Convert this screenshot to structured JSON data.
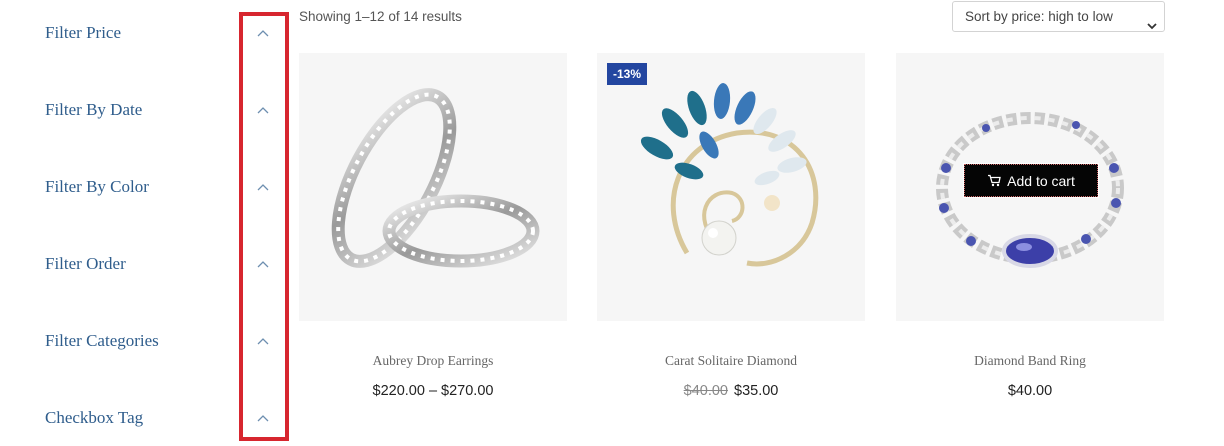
{
  "sidebar": {
    "filters": [
      {
        "label": "Filter Price"
      },
      {
        "label": "Filter By Date"
      },
      {
        "label": "Filter By Color"
      },
      {
        "label": "Filter Order"
      },
      {
        "label": "Filter Categories"
      },
      {
        "label": "Checkbox Tag"
      }
    ],
    "highlight_color": "#d7262f"
  },
  "toolbar": {
    "result_count": "Showing 1–12 of 14 results",
    "sort_selected": "Sort by price: high to low"
  },
  "products": [
    {
      "name": "Aubrey Drop Earrings",
      "price": "$220.00 – $270.00",
      "image": "silver-diamond-rings"
    },
    {
      "name": "Carat Solitaire Diamond",
      "old_price": "$40.00",
      "price": "$35.00",
      "badge": "-13%",
      "image": "pearl-leaf-brooch"
    },
    {
      "name": "Diamond Band Ring",
      "price": "$40.00",
      "add_to_cart": "Add to cart",
      "image": "sapphire-bracelet"
    }
  ],
  "colors": {
    "accent": "#2f5d8c",
    "badge": "#2346a0",
    "button": "#050505"
  }
}
